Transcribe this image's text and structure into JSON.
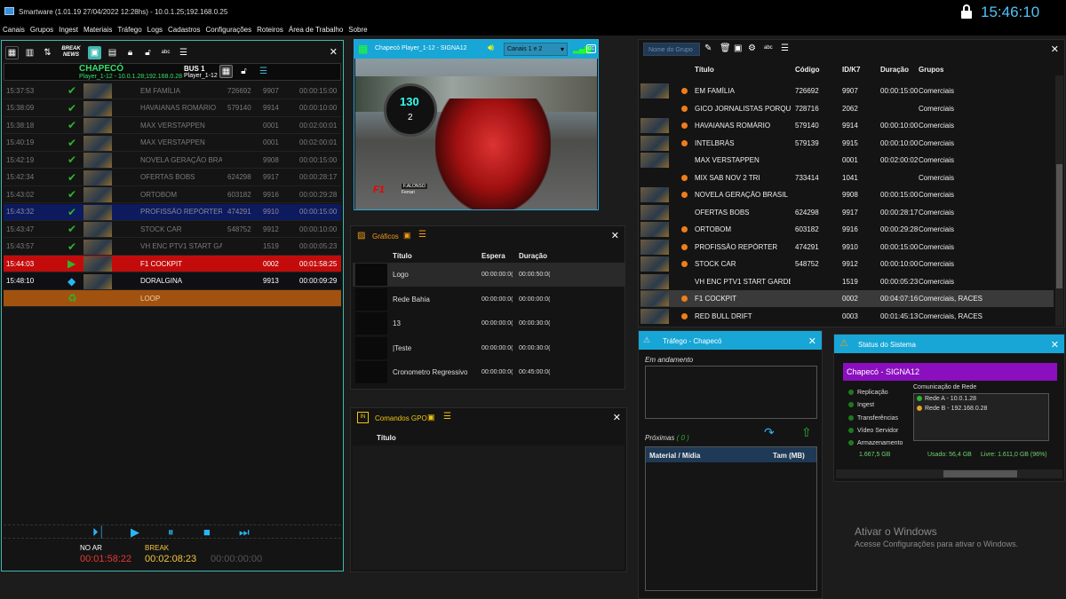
{
  "window": {
    "title": "Smartware (1.01.19 27/04/2022 12:28hs) - 10.0.1.25;192.168.0.25",
    "clock": "15:46:10"
  },
  "menu": [
    "Canais",
    "Grupos",
    "Ingest",
    "Materiais",
    "Tráfego",
    "Logs",
    "Cadastros",
    "Configurações",
    "Roteiros",
    "Área de Trabalho",
    "Sobre"
  ],
  "playlist": {
    "toolbar_logo": "BREAK NEWS",
    "channel": "CHAPECÓ",
    "player": "Player_1-12 - 10.0.1.28;192.168.0.28",
    "bus": "BUS 1",
    "bus_player": "Player_1-12",
    "rows": [
      {
        "time": "15:37:53",
        "title": "EM FAMÍLIA",
        "code": "726692",
        "id": "9907",
        "dur": "00:00:15:00",
        "state": "done"
      },
      {
        "time": "15:38:09",
        "title": "HAVAIANAS ROMÁRIO",
        "code": "579140",
        "id": "9914",
        "dur": "00:00:10:00",
        "state": "done"
      },
      {
        "time": "15:38:18",
        "title": "MAX VERSTAPPEN",
        "code": "",
        "id": "0001",
        "dur": "00:02:00:01",
        "state": "done"
      },
      {
        "time": "15:40:19",
        "title": "MAX VERSTAPPEN",
        "code": "",
        "id": "0001",
        "dur": "00:02:00:01",
        "state": "done"
      },
      {
        "time": "15:42:19",
        "title": "NOVELA GERAÇÃO BRASIL",
        "code": "",
        "id": "9908",
        "dur": "00:00:15:00",
        "state": "done"
      },
      {
        "time": "15:42:34",
        "title": "OFERTAS BOBS",
        "code": "624298",
        "id": "9917",
        "dur": "00:00:28:17",
        "state": "done"
      },
      {
        "time": "15:43:02",
        "title": "ORTOBOM",
        "code": "603182",
        "id": "9916",
        "dur": "00:00:29:28",
        "state": "done"
      },
      {
        "time": "15:43:32",
        "title": "PROFISSÃO REPÓRTER",
        "code": "474291",
        "id": "9910",
        "dur": "00:00:15:00",
        "state": "selected"
      },
      {
        "time": "15:43:47",
        "title": "STOCK CAR",
        "code": "548752",
        "id": "9912",
        "dur": "00:00:10:00",
        "state": "done"
      },
      {
        "time": "15:43:57",
        "title": "VH ENC PTV1 START GARDI",
        "code": "",
        "id": "1519",
        "dur": "00:00:05:23",
        "state": "done"
      },
      {
        "time": "15:44:03",
        "title": "F1 COCKPIT",
        "code": "",
        "id": "0002",
        "dur": "00:01:58:25",
        "state": "onair"
      },
      {
        "time": "15:48:10",
        "title": "DORALGINA",
        "code": "",
        "id": "9913",
        "dur": "00:00:09:29",
        "state": "next"
      },
      {
        "time": "",
        "title": "LOOP",
        "code": "",
        "id": "",
        "dur": "",
        "state": "loop"
      }
    ],
    "no_ar_label": "NO AR",
    "no_ar_time": "00:01:58:22",
    "break_label": "BREAK",
    "break_time": "00:02:08:23",
    "third_time": "00:00:00:00"
  },
  "preview": {
    "title": "Chapecó Player_1-12 - SIGNA12",
    "audio": "Canais 1 e 2",
    "cc": "CC",
    "speed": "130",
    "gear": "2",
    "driver": "F.ALONSO",
    "team": "Ferrari"
  },
  "graficos": {
    "title": "Gráficos",
    "cols": [
      "Título",
      "Espera",
      "Duração"
    ],
    "rows": [
      {
        "title": "Logo",
        "espera": "00:00:00:0(",
        "dur": "00:00:50:0("
      },
      {
        "title": "Rede Bahia",
        "espera": "00:00:00:0(",
        "dur": "00:00:00:0("
      },
      {
        "title": "13",
        "espera": "00:00:00:0(",
        "dur": "00:00:30:0("
      },
      {
        "title": "|Teste",
        "espera": "00:00:00:0(",
        "dur": "00:00:30:0("
      },
      {
        "title": "Cronometro Regressivo",
        "espera": "00:00:00:0(",
        "dur": "00:45:00:0("
      }
    ]
  },
  "gpo": {
    "title": "Comandos GPO",
    "col": "Título"
  },
  "materiais": {
    "group_placeholder": "Nome do Grupo",
    "cols": [
      "Título",
      "Código",
      "ID/K7",
      "Duração",
      "Grupos"
    ],
    "rows": [
      {
        "title": "EM FAMÍLIA",
        "code": "726692",
        "id": "9907",
        "dur": "00:00:15:00",
        "group": "Comerciais",
        "dot": true,
        "thumb": true
      },
      {
        "title": "GICO JORNALISTAS PORQUE D",
        "code": "728716",
        "id": "2062",
        "dur": "",
        "group": "Comerciais",
        "dot": true,
        "thumb": false
      },
      {
        "title": "HAVAIANAS ROMÁRIO",
        "code": "579140",
        "id": "9914",
        "dur": "00:00:10:00",
        "group": "Comerciais",
        "dot": true,
        "thumb": true
      },
      {
        "title": "INTELBRÁS",
        "code": "579139",
        "id": "9915",
        "dur": "00:00:10:00",
        "group": "Comerciais",
        "dot": true,
        "thumb": true
      },
      {
        "title": "MAX VERSTAPPEN",
        "code": "",
        "id": "0001",
        "dur": "00:02:00:02",
        "group": "Comerciais",
        "dot": false,
        "thumb": true
      },
      {
        "title": "MIX SAB NOV 2 TRI",
        "code": "733414",
        "id": "1041",
        "dur": "",
        "group": "Comerciais",
        "dot": true,
        "thumb": false
      },
      {
        "title": "NOVELA GERAÇÃO BRASIL",
        "code": "",
        "id": "9908",
        "dur": "00:00:15:00",
        "group": "Comerciais",
        "dot": true,
        "thumb": true
      },
      {
        "title": "OFERTAS BOBS",
        "code": "624298",
        "id": "9917",
        "dur": "00:00:28:17",
        "group": "Comerciais",
        "dot": false,
        "thumb": true
      },
      {
        "title": "ORTOBOM",
        "code": "603182",
        "id": "9916",
        "dur": "00:00:29:28",
        "group": "Comerciais",
        "dot": true,
        "thumb": true
      },
      {
        "title": "PROFISSÃO REPÓRTER",
        "code": "474291",
        "id": "9910",
        "dur": "00:00:15:00",
        "group": "Comerciais",
        "dot": true,
        "thumb": true
      },
      {
        "title": "STOCK CAR",
        "code": "548752",
        "id": "9912",
        "dur": "00:00:10:00",
        "group": "Comerciais",
        "dot": true,
        "thumb": true
      },
      {
        "title": "VH ENC PTV1 START GARDE F",
        "code": "",
        "id": "1519",
        "dur": "00:00:05:23",
        "group": "Comerciais",
        "dot": false,
        "thumb": true
      },
      {
        "title": "F1 COCKPIT",
        "code": "",
        "id": "0002",
        "dur": "00:04:07:16",
        "group": "Comerciais, RACES",
        "dot": true,
        "thumb": true,
        "sel": true
      },
      {
        "title": "RED BULL DRIFT",
        "code": "",
        "id": "0003",
        "dur": "00:01:45:13",
        "group": "Comerciais, RACES",
        "dot": true,
        "thumb": true
      }
    ]
  },
  "trafego": {
    "title": "Tráfego - Chapecó",
    "andamento": "Em andamento",
    "proximas": "Próximas",
    "proximas_count": "( 0 )",
    "cols": [
      "Material / Mídia",
      "Tam (MB)"
    ]
  },
  "status": {
    "title": "Status do Sistema",
    "station": "Chapecó - SIGNA12",
    "items": [
      "Replicação",
      "Ingest",
      "Transferências",
      "Vídeo Servidor",
      "Armazenamento"
    ],
    "net_title": "Comunicação de Rede",
    "net": [
      {
        "label": "Rede A - 10.0.1.28",
        "color": "#2db52d"
      },
      {
        "label": "Rede B - 192.168.0.28",
        "color": "#e8a321"
      }
    ],
    "storage_total": "1.667,5 GB",
    "used_label": "Usado:",
    "used": "56,4 GB",
    "free_label": "Livre:",
    "free": "1.611,0 GB (96%)"
  },
  "watermark": {
    "title": "Ativar o Windows",
    "sub": "Acesse Configurações para ativar o Windows."
  }
}
